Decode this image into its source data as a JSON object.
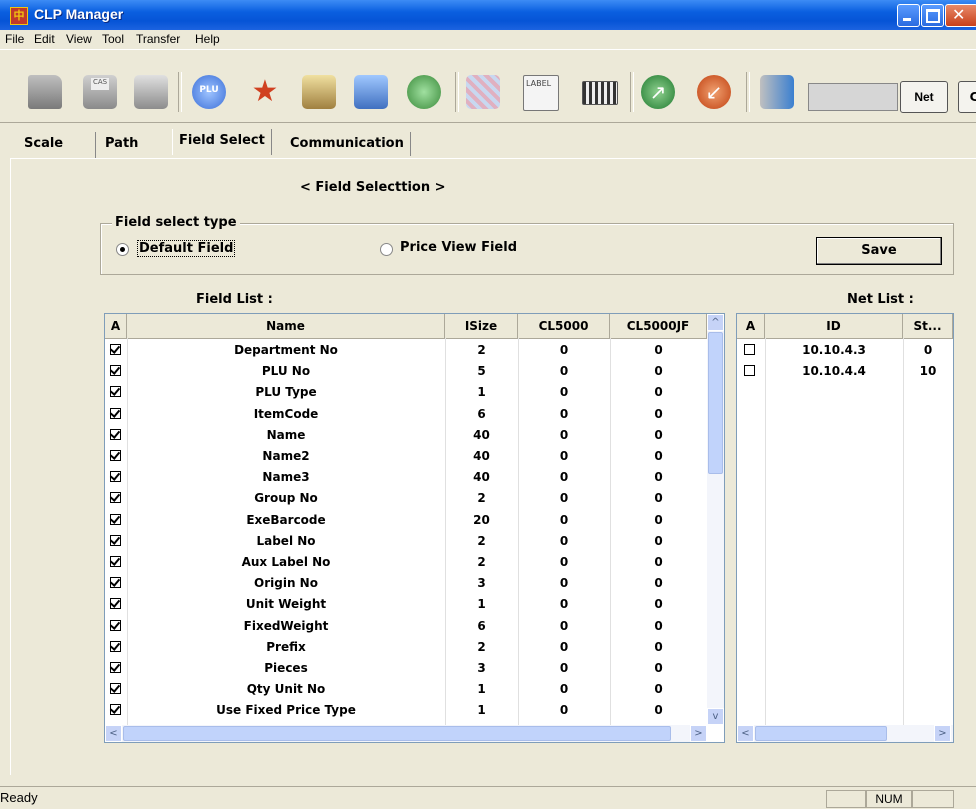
{
  "window": {
    "title": "CLP Manager",
    "app_icon_glyph": "中"
  },
  "menu": [
    "File",
    "Edit",
    "View",
    "Tool",
    "Transfer",
    "Help"
  ],
  "toolbar": {
    "icons": [
      "open-folder-icon",
      "save-icon",
      "print-icon",
      "plu-icon",
      "star-icon",
      "upload-icon",
      "download-icon",
      "users-icon",
      "data-icon",
      "label-icon",
      "keyboard-icon",
      "send-icon",
      "receive-icon",
      "settings-icon"
    ],
    "plu_label": "PLU",
    "label_label": "LABEL",
    "net_button": "Net",
    "extra_button": "C"
  },
  "tabs": [
    "Scale",
    "Path",
    "Field Select",
    "Communication"
  ],
  "active_tab": "Field Select",
  "section_title": "< Field Selecttion >",
  "field_select": {
    "group_title": "Field select type",
    "options": [
      "Default Field",
      "Price View Field"
    ],
    "selected": "Default Field",
    "save_button": "Save"
  },
  "field_list": {
    "title": "Field List :",
    "columns": [
      "A",
      "Name",
      "ISize",
      "CL5000",
      "CL5000JF"
    ],
    "rows": [
      {
        "checked": true,
        "name": "Department No",
        "isize": "2",
        "cl5000": "0",
        "cl5000jf": "0"
      },
      {
        "checked": true,
        "name": "PLU No",
        "isize": "5",
        "cl5000": "0",
        "cl5000jf": "0"
      },
      {
        "checked": true,
        "name": "PLU Type",
        "isize": "1",
        "cl5000": "0",
        "cl5000jf": "0"
      },
      {
        "checked": true,
        "name": "ItemCode",
        "isize": "6",
        "cl5000": "0",
        "cl5000jf": "0"
      },
      {
        "checked": true,
        "name": "Name",
        "isize": "40",
        "cl5000": "0",
        "cl5000jf": "0"
      },
      {
        "checked": true,
        "name": "Name2",
        "isize": "40",
        "cl5000": "0",
        "cl5000jf": "0"
      },
      {
        "checked": true,
        "name": "Name3",
        "isize": "40",
        "cl5000": "0",
        "cl5000jf": "0"
      },
      {
        "checked": true,
        "name": "Group No",
        "isize": "2",
        "cl5000": "0",
        "cl5000jf": "0"
      },
      {
        "checked": true,
        "name": "ExeBarcode",
        "isize": "20",
        "cl5000": "0",
        "cl5000jf": "0"
      },
      {
        "checked": true,
        "name": "Label No",
        "isize": "2",
        "cl5000": "0",
        "cl5000jf": "0"
      },
      {
        "checked": true,
        "name": "Aux Label No",
        "isize": "2",
        "cl5000": "0",
        "cl5000jf": "0"
      },
      {
        "checked": true,
        "name": "Origin No",
        "isize": "3",
        "cl5000": "0",
        "cl5000jf": "0"
      },
      {
        "checked": true,
        "name": "Unit Weight",
        "isize": "1",
        "cl5000": "0",
        "cl5000jf": "0"
      },
      {
        "checked": true,
        "name": "FixedWeight",
        "isize": "6",
        "cl5000": "0",
        "cl5000jf": "0"
      },
      {
        "checked": true,
        "name": "Prefix",
        "isize": "2",
        "cl5000": "0",
        "cl5000jf": "0"
      },
      {
        "checked": true,
        "name": "Pieces",
        "isize": "3",
        "cl5000": "0",
        "cl5000jf": "0"
      },
      {
        "checked": true,
        "name": "Qty Unit No",
        "isize": "1",
        "cl5000": "0",
        "cl5000jf": "0"
      },
      {
        "checked": true,
        "name": "Use Fixed Price Type",
        "isize": "1",
        "cl5000": "0",
        "cl5000jf": "0"
      }
    ]
  },
  "net_list": {
    "title": "Net List :",
    "columns": [
      "A",
      "ID",
      "St..."
    ],
    "rows": [
      {
        "checked": false,
        "id": "10.10.4.3",
        "st": "0"
      },
      {
        "checked": false,
        "id": "10.10.4.4",
        "st": "10"
      }
    ]
  },
  "status": {
    "text": "Ready",
    "num": "NUM"
  },
  "colors": {
    "titlebar": "#0654d6",
    "background": "#ece9d8",
    "grid_border": "#7f9db9"
  }
}
